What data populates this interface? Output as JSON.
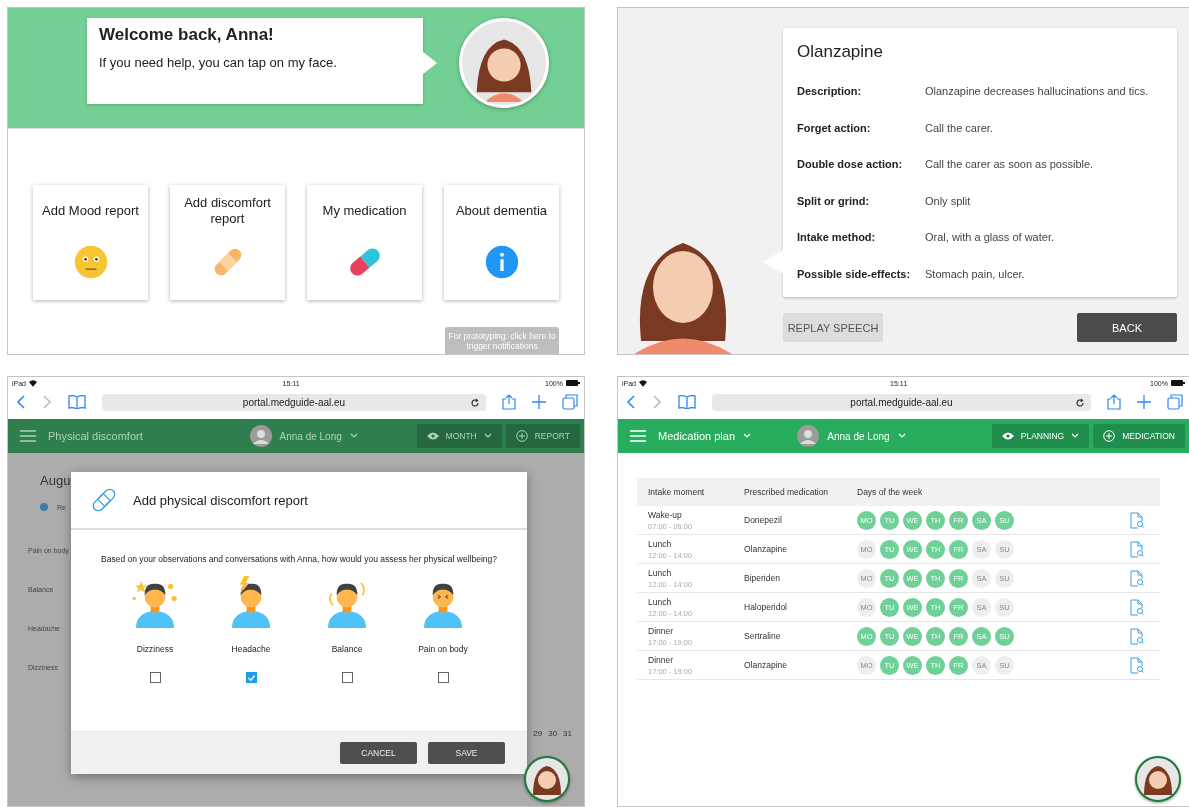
{
  "welcome": {
    "title": "Welcome back, Anna!",
    "text": "If you need help, you can tap on my face.",
    "tiles": [
      {
        "label": "Add Mood report",
        "kind": "mood"
      },
      {
        "label": "Add discomfort report",
        "kind": "bandage"
      },
      {
        "label": "My medication",
        "kind": "pill"
      },
      {
        "label": "About dementia",
        "kind": "info"
      }
    ],
    "prototype_note": "For prototyping: click here to trigger notifications"
  },
  "medication_info": {
    "title": "Olanzapine",
    "fields": [
      {
        "label": "Description:",
        "value": "Olanzapine decreases hallucinations and tics."
      },
      {
        "label": "Forget action:",
        "value": "Call the carer."
      },
      {
        "label": "Double dose action:",
        "value": "Call the carer as soon as possible."
      },
      {
        "label": "Split or grind:",
        "value": "Only split"
      },
      {
        "label": "Intake method:",
        "value": "Oral, with a glass of water."
      },
      {
        "label": "Possible side-effects:",
        "value": "Stomach pain, ulcer."
      }
    ],
    "buttons": [
      {
        "label": "REPLAY SPEECH",
        "kind": "secondary"
      },
      {
        "label": "BACK",
        "kind": "primary"
      }
    ]
  },
  "discomfort_screen": {
    "status_bar": {
      "device": "iPad",
      "time": "15:11",
      "battery": "100%"
    },
    "url": "portal.medguide-aal.eu",
    "app_bar": {
      "title": "Physical discomfort",
      "user": "Anna de Long",
      "view_button": "MONTH",
      "action_button": "REPORT"
    },
    "background": {
      "heading": "Augu",
      "legend": "Re",
      "rows": [
        "Pain on body",
        "Balance",
        "Headache",
        "Dizziness"
      ],
      "days": [
        "29",
        "30",
        "31"
      ]
    },
    "dialog": {
      "title": "Add physical discomfort report",
      "question": "Based on your observations and conversations with Anna, how would you assess her physical wellbeing?",
      "options": [
        {
          "label": "Dizziness",
          "kind": "dizzy",
          "checked": false
        },
        {
          "label": "Headache",
          "kind": "headache",
          "checked": true
        },
        {
          "label": "Balance",
          "kind": "balance",
          "checked": false
        },
        {
          "label": "Pain on body",
          "kind": "pain",
          "checked": false
        }
      ],
      "buttons": [
        "CANCEL",
        "SAVE"
      ]
    }
  },
  "medication_plan": {
    "status_bar": {
      "device": "iPad",
      "time": "15:11",
      "battery": "100%"
    },
    "url": "portal.medguide-aal.eu",
    "app_bar": {
      "title": "Medication plan",
      "user": "Anna de Long",
      "view_button": "PLANNING",
      "action_button": "MEDICATION"
    },
    "columns": [
      "Intake moment",
      "Prescribed medication",
      "Days of the week"
    ],
    "rows": [
      {
        "moment": "Wake-up",
        "time": "07:00 - 09:00",
        "medication": "Donepezil",
        "days": [
          {
            "label": "MO",
            "on": true
          },
          {
            "label": "TU",
            "on": true
          },
          {
            "label": "WE",
            "on": true
          },
          {
            "label": "TH",
            "on": true
          },
          {
            "label": "FR",
            "on": true
          },
          {
            "label": "SA",
            "on": true
          },
          {
            "label": "SU",
            "on": true
          }
        ]
      },
      {
        "moment": "Lunch",
        "time": "12:00 - 14:00",
        "medication": "Olanzapine",
        "days": [
          {
            "label": "MO",
            "on": false
          },
          {
            "label": "TU",
            "on": true
          },
          {
            "label": "WE",
            "on": true
          },
          {
            "label": "TH",
            "on": true
          },
          {
            "label": "FR",
            "on": true
          },
          {
            "label": "SA",
            "on": false
          },
          {
            "label": "SU",
            "on": false
          }
        ]
      },
      {
        "moment": "Lunch",
        "time": "12:00 - 14:00",
        "medication": "Biperiden",
        "days": [
          {
            "label": "MO",
            "on": false
          },
          {
            "label": "TU",
            "on": true
          },
          {
            "label": "WE",
            "on": true
          },
          {
            "label": "TH",
            "on": true
          },
          {
            "label": "FR",
            "on": true
          },
          {
            "label": "SA",
            "on": false
          },
          {
            "label": "SU",
            "on": false
          }
        ]
      },
      {
        "moment": "Lunch",
        "time": "12:00 - 14:00",
        "medication": "Haloperidol",
        "days": [
          {
            "label": "MO",
            "on": false
          },
          {
            "label": "TU",
            "on": true
          },
          {
            "label": "WE",
            "on": true
          },
          {
            "label": "TH",
            "on": true
          },
          {
            "label": "FR",
            "on": true
          },
          {
            "label": "SA",
            "on": false
          },
          {
            "label": "SU",
            "on": false
          }
        ]
      },
      {
        "moment": "Dinner",
        "time": "17:00 - 19:00",
        "medication": "Sertraline",
        "days": [
          {
            "label": "MO",
            "on": true
          },
          {
            "label": "TU",
            "on": true
          },
          {
            "label": "WE",
            "on": true
          },
          {
            "label": "TH",
            "on": true
          },
          {
            "label": "FR",
            "on": true
          },
          {
            "label": "SA",
            "on": true
          },
          {
            "label": "SU",
            "on": true
          }
        ]
      },
      {
        "moment": "Dinner",
        "time": "17:00 - 19:00",
        "medication": "Olanzapine",
        "days": [
          {
            "label": "MO",
            "on": false
          },
          {
            "label": "TU",
            "on": true
          },
          {
            "label": "WE",
            "on": true
          },
          {
            "label": "TH",
            "on": true
          },
          {
            "label": "FR",
            "on": true
          },
          {
            "label": "SA",
            "on": false
          },
          {
            "label": "SU",
            "on": false
          }
        ]
      }
    ]
  }
}
